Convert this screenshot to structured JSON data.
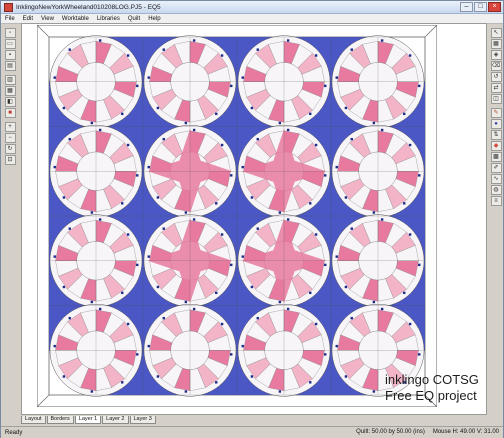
{
  "window": {
    "title": "InklingoNewYorkWheeland010208LOG.PJ5 - EQ5"
  },
  "menu": {
    "items": [
      "File",
      "Edit",
      "View",
      "Worktable",
      "Libraries",
      "Quilt",
      "Help"
    ]
  },
  "toolbar_left": {
    "icons": [
      "new-icon",
      "open-icon",
      "save-icon",
      "print-icon",
      "sketchbook-icon",
      "library-icon",
      "worktable-icon",
      "fabric-icon",
      "zoom-in-icon",
      "zoom-out-icon",
      "refresh-icon",
      "fit-icon"
    ]
  },
  "toolbar_right": {
    "icons": [
      "pick-icon",
      "set-block-icon",
      "set-applique-icon",
      "erase-icon",
      "rotate-icon",
      "flip-icon",
      "symmetry-icon",
      "paintbrush-icon",
      "spraycan-icon",
      "swap-icon",
      "color-icon",
      "fabric-icon",
      "eyedropper-icon",
      "thread-icon",
      "stencil-icon",
      "adjust-icon"
    ]
  },
  "tabs": [
    "Layout",
    "Borders",
    "Layer 1",
    "Layer 2",
    "Layer 3"
  ],
  "active_tab": "Layer 1",
  "statusbar": {
    "left": "Ready",
    "quilt": "Quilt: 50.00 by 50.00 (ins)",
    "mouse": "Mouse  H: 49.00  V: 31.00"
  },
  "overlay": {
    "line1": "inklingo COTSG",
    "line2": "Free EQ project"
  },
  "colors": {
    "blue": "#4a57c4",
    "blue_dark": "#3a45a8",
    "pink": "#e87aa0",
    "pink_light": "#f3b4c8",
    "white": "#f7f5f7",
    "navy": "#1e2a8a"
  }
}
